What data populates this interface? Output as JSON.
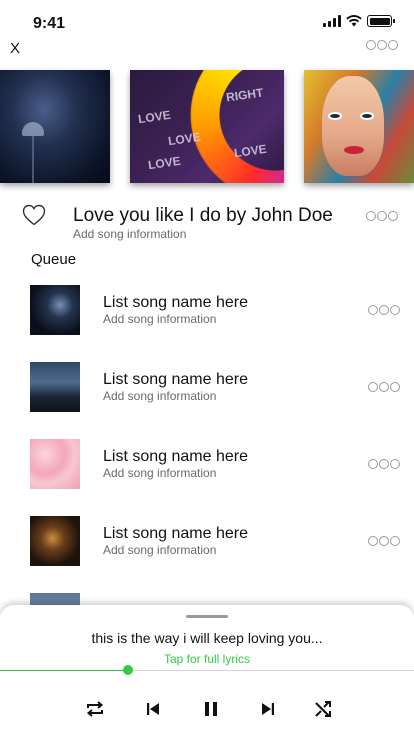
{
  "status_bar": {
    "time": "9:41"
  },
  "header": {
    "close_label": "X",
    "more_icon": "more-icon"
  },
  "carousel": {
    "items": [
      "concert-art",
      "rainbow-art",
      "face-mural-art"
    ]
  },
  "now_playing": {
    "title": "Love you like I do by John Doe",
    "subtitle": "Add song information"
  },
  "queue": {
    "label": "Queue",
    "items": [
      {
        "title": "List song name here",
        "subtitle": "Add song information"
      },
      {
        "title": "List song name here",
        "subtitle": "Add song information"
      },
      {
        "title": "List song name here",
        "subtitle": "Add song information"
      },
      {
        "title": "List song name here",
        "subtitle": "Add song information"
      }
    ]
  },
  "player": {
    "lyric": "this is the way i will keep loving you...",
    "lyric_link": "Tap for full lyrics",
    "progress": 0.31,
    "controls": [
      "repeat-icon",
      "previous-icon",
      "pause-icon",
      "next-icon",
      "shuffle-icon"
    ]
  },
  "colors": {
    "accent": "#2ecc40",
    "muted": "#6a6a6a",
    "dots": "#9a9a9a"
  }
}
